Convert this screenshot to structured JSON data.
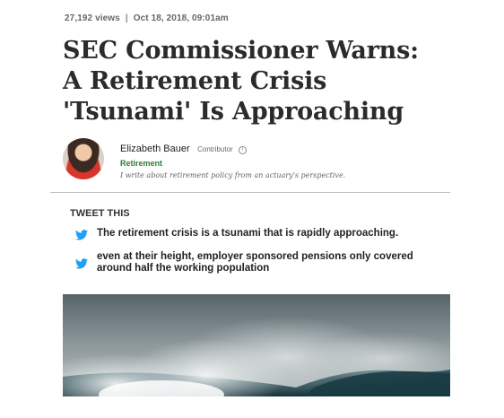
{
  "article": {
    "views": "27,192 views",
    "separator": "|",
    "date": "Oct 18, 2018, 09:01am",
    "headline": "SEC Commissioner Warns: A Retirement Crisis 'Tsunami' Is Approaching"
  },
  "author": {
    "name": "Elizabeth Bauer",
    "role": "Contributor",
    "info_icon": "i",
    "channel": "Retirement",
    "bio": "I write about retirement policy from an actuary's perspective."
  },
  "tweet_this": {
    "heading": "TWEET THIS",
    "tweets": [
      {
        "text": "The retirement crisis is a tsunami that is rapidly approaching."
      },
      {
        "text": "even at their height, employer sponsored pensions only covered around half the working population"
      }
    ]
  },
  "colors": {
    "channel_green": "#2e7d32",
    "twitter_blue": "#1da1f2"
  },
  "icons": {
    "tweet": "twitter-bird-icon",
    "info": "info-icon"
  }
}
